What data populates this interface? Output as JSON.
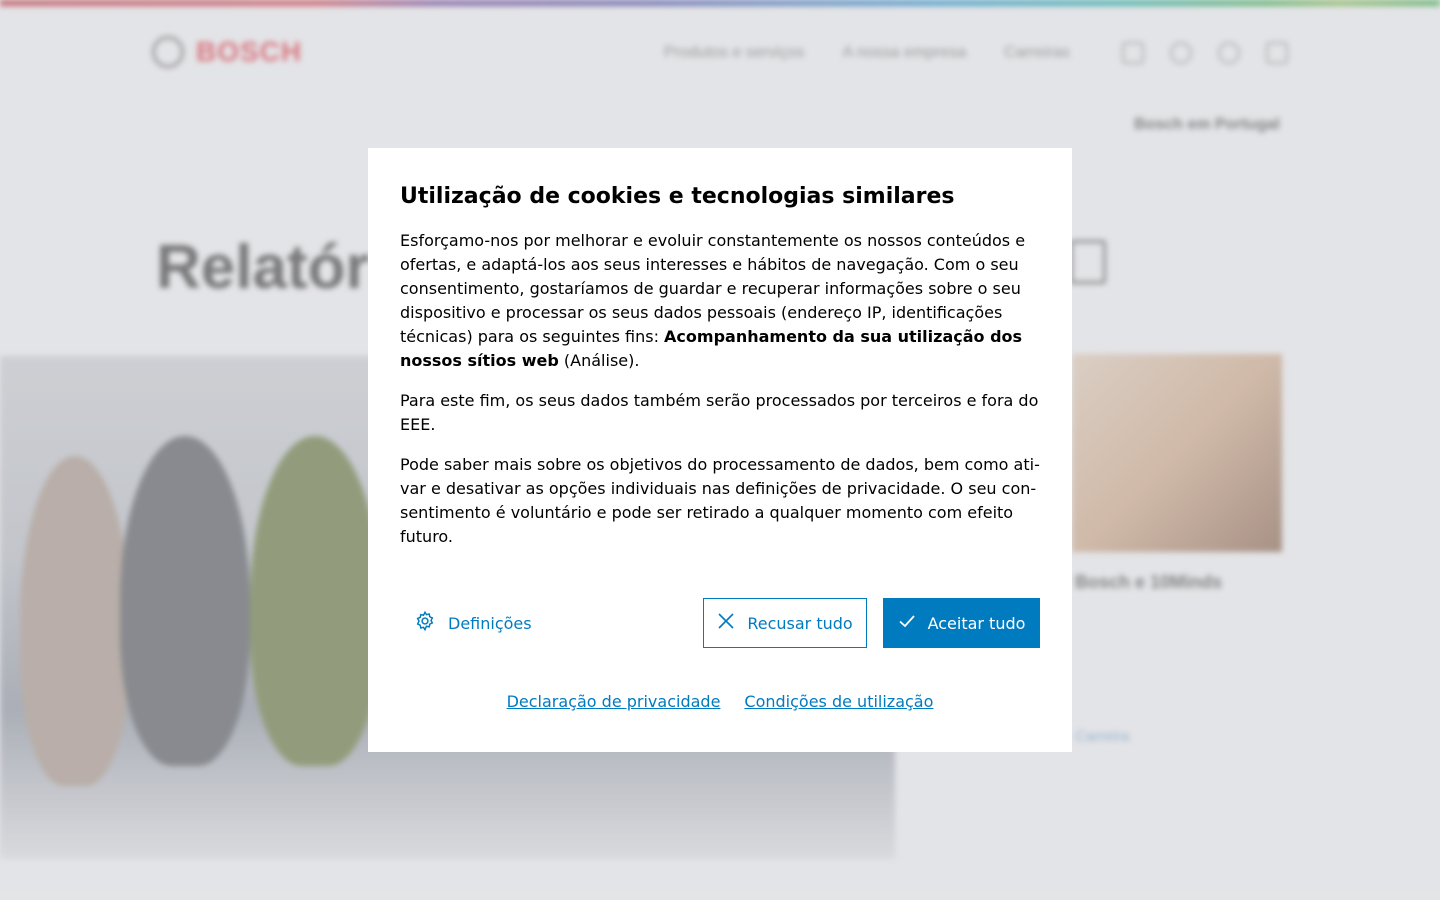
{
  "colors": {
    "accent": "#007bc0",
    "brand_red": "#d6434e"
  },
  "background": {
    "logo_text": "BOSCH",
    "nav": [
      "Produtos e serviços",
      "A nossa empresa",
      "Carreiras"
    ],
    "nav_icons": [
      "mail-icon",
      "search-icon",
      "globe-icon",
      "menu-icon"
    ],
    "country": "Bosch em Portugal",
    "hero_title": "Relatório",
    "card_title": "Bosch e 10Minds",
    "links": [
      "",
      "Carreira"
    ]
  },
  "dialog": {
    "title": "Utilização de cookies e tecnologias similares",
    "p1_text": "Esforçamo-nos por melhorar e evoluir constantemente os nossos conteúdos e ofertas, e adaptá-los aos seus interesses e hábitos de navegação. Com o seu con­sentimento, gostaríamos de guardar e recuperar informações sobre o seu disposi­tivo e processar os seus dados pessoais (endereço IP, identificações técnicas) para os seguintes fins: ",
    "p1_bold": "Acompanhamento da sua utilização dos nossos sítios web",
    "p1_tail": " (Análise).",
    "p2": "Para este fim, os seus dados também serão processados por terceiros e fora do EEE.",
    "p3": "Pode saber mais sobre os objetivos do processamento de dados, bem como ati­var e desativar as opções individuais nas definições de privacidade. O seu con­sentimento é voluntário e pode ser retirado a qualquer momento com efeito futuro.",
    "settings_label": "Definições",
    "refuse_label": "Recusar tudo",
    "accept_label": "Aceitar tudo",
    "privacy_link": "Declaração de privacidade",
    "terms_link": "Condições de utilização"
  }
}
